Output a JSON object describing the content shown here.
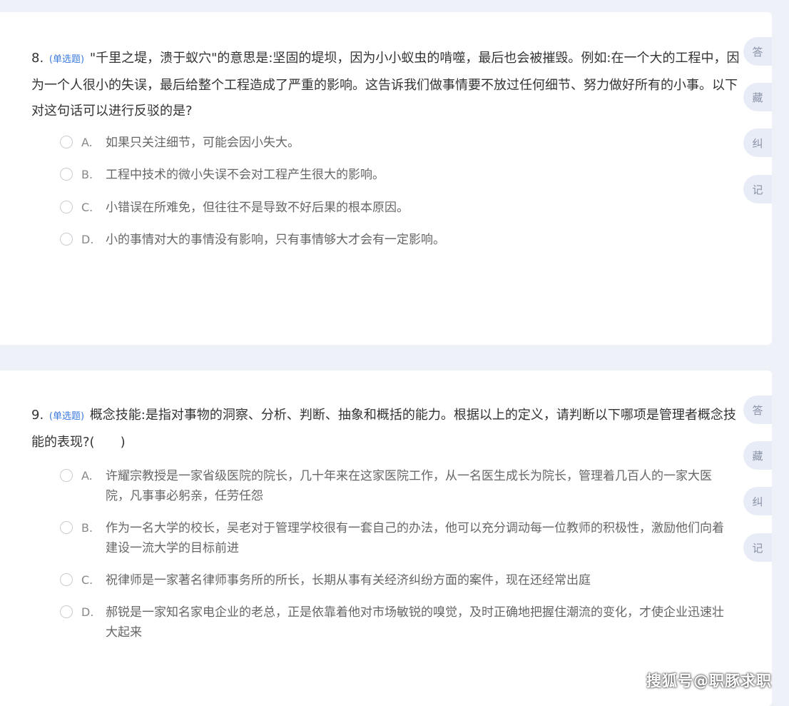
{
  "questions": [
    {
      "number": "8.",
      "type": "(单选题)",
      "text": "\"千里之堤，溃于蚁穴\"的意思是:坚固的堤坝，因为小小蚁虫的啃噬，最后也会被摧毁。例如:在一个大的工程中，因为一个人很小的失误，最后给整个工程造成了严重的影响。这告诉我们做事情要不放过任何细节、努力做好所有的小事。以下对这句话可以进行反驳的是?",
      "options": [
        {
          "letter": "A.",
          "text": "如果只关注细节，可能会因小失大。"
        },
        {
          "letter": "B.",
          "text": "工程中技术的微小失误不会对工程产生很大的影响。"
        },
        {
          "letter": "C.",
          "text": "小错误在所难免，但往往不是导致不好后果的根本原因。"
        },
        {
          "letter": "D.",
          "text": "小的事情对大的事情没有影响，只有事情够大才会有一定影响。"
        }
      ]
    },
    {
      "number": "9.",
      "type": "(单选题)",
      "text": "概念技能:是指对事物的洞察、分析、判断、抽象和概括的能力。根据以上的定义，请判断以下哪项是管理者概念技能的表现?(　　)",
      "options": [
        {
          "letter": "A.",
          "text": "许耀宗教授是一家省级医院的院长，几十年来在这家医院工作，从一名医生成长为院长，管理着几百人的一家大医院，凡事事必躬亲，任劳任怨"
        },
        {
          "letter": "B.",
          "text": "作为一名大学的校长，吴老对于管理学校很有一套自己的办法，他可以充分调动每一位教师的积极性，激励他们向着建设一流大学的目标前进"
        },
        {
          "letter": "C.",
          "text": "祝律师是一家著名律师事务所的所长，长期从事有关经济纠纷方面的案件，现在还经常出庭"
        },
        {
          "letter": "D.",
          "text": "郝锐是一家知名家电企业的老总，正是依靠着他对市场敏锐的嗅觉，及时正确地把握住潮流的变化，才使企业迅速壮大起来"
        }
      ]
    }
  ],
  "side_buttons": {
    "answer": "答",
    "collect": "藏",
    "correct": "纠",
    "note": "记"
  },
  "watermark": "搜狐号@职豚求职"
}
